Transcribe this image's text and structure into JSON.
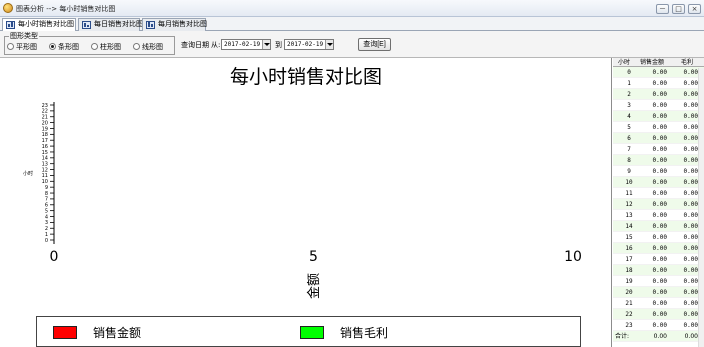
{
  "window": {
    "title": "图表分析 --> 每小时销售对比图",
    "buttons": [
      "－",
      "□",
      "×"
    ]
  },
  "tabs": [
    {
      "label": "每小时销售对比图",
      "active": true
    },
    {
      "label": "每日销售对比图",
      "active": false
    },
    {
      "label": "每月销售对比图",
      "active": false
    }
  ],
  "toolbar": {
    "group_label": "图形类型",
    "radios": [
      {
        "label": "平形图",
        "selected": false
      },
      {
        "label": "条形图",
        "selected": true
      },
      {
        "label": "柱形图",
        "selected": false
      },
      {
        "label": "线形图",
        "selected": false
      }
    ],
    "query_date_label": "查询日期",
    "from_label": "从:",
    "to_label": "到",
    "date_from": "2017-02-19",
    "date_to": "2017-02-19",
    "query_button": "查询[E]"
  },
  "chart_data": {
    "type": "bar",
    "orientation": "horizontal",
    "title": "每小时销售对比图",
    "ylabel": "小时",
    "xlabel": "金额",
    "categories": [
      "0",
      "1",
      "2",
      "3",
      "4",
      "5",
      "6",
      "7",
      "8",
      "9",
      "10",
      "11",
      "12",
      "13",
      "14",
      "15",
      "16",
      "17",
      "18",
      "19",
      "20",
      "21",
      "22",
      "23"
    ],
    "series": [
      {
        "name": "销售金额",
        "color": "#ff0000",
        "values": [
          0,
          0,
          0,
          0,
          0,
          0,
          0,
          0,
          0,
          0,
          0,
          0,
          0,
          0,
          0,
          0,
          0,
          0,
          0,
          0,
          0,
          0,
          0,
          0
        ]
      },
      {
        "name": "销售毛利",
        "color": "#00ff00",
        "values": [
          0,
          0,
          0,
          0,
          0,
          0,
          0,
          0,
          0,
          0,
          0,
          0,
          0,
          0,
          0,
          0,
          0,
          0,
          0,
          0,
          0,
          0,
          0,
          0
        ]
      }
    ],
    "xlim": [
      0,
      10
    ],
    "xticks": [
      "0",
      "5",
      "10"
    ],
    "legend_position": "bottom",
    "grid": false
  },
  "table": {
    "columns": [
      "小时",
      "销售金额",
      "毛利"
    ],
    "rows": [
      [
        "0",
        "0.00",
        "0.00"
      ],
      [
        "1",
        "0.00",
        "0.00"
      ],
      [
        "2",
        "0.00",
        "0.00"
      ],
      [
        "3",
        "0.00",
        "0.00"
      ],
      [
        "4",
        "0.00",
        "0.00"
      ],
      [
        "5",
        "0.00",
        "0.00"
      ],
      [
        "6",
        "0.00",
        "0.00"
      ],
      [
        "7",
        "0.00",
        "0.00"
      ],
      [
        "8",
        "0.00",
        "0.00"
      ],
      [
        "9",
        "0.00",
        "0.00"
      ],
      [
        "10",
        "0.00",
        "0.00"
      ],
      [
        "11",
        "0.00",
        "0.00"
      ],
      [
        "12",
        "0.00",
        "0.00"
      ],
      [
        "13",
        "0.00",
        "0.00"
      ],
      [
        "14",
        "0.00",
        "0.00"
      ],
      [
        "15",
        "0.00",
        "0.00"
      ],
      [
        "16",
        "0.00",
        "0.00"
      ],
      [
        "17",
        "0.00",
        "0.00"
      ],
      [
        "18",
        "0.00",
        "0.00"
      ],
      [
        "19",
        "0.00",
        "0.00"
      ],
      [
        "20",
        "0.00",
        "0.00"
      ],
      [
        "21",
        "0.00",
        "0.00"
      ],
      [
        "22",
        "0.00",
        "0.00"
      ],
      [
        "23",
        "0.00",
        "0.00"
      ]
    ],
    "total": [
      "合计:",
      "0.00",
      "0.00"
    ]
  }
}
